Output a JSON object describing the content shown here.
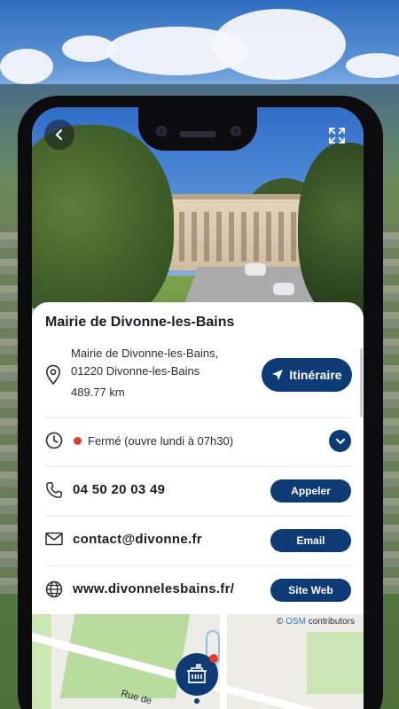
{
  "place": {
    "title": "Mairie de Divonne-les-Bains",
    "address_line1": "Mairie de Divonne-les-Bains,",
    "address_line2": "01220 Divonne-les-Bains",
    "distance": "489.77 km",
    "directions_label": "Itinéraire"
  },
  "hours": {
    "status_text": "Fermé (ouvre lundi à 07h30)",
    "status_color": "#e03a2e"
  },
  "contact": {
    "phone": "04 50 20 03 49",
    "phone_button": "Appeler",
    "email": "contact@divonne.fr",
    "email_button": "Email",
    "website": "www.divonnelesbains.fr/",
    "website_button": "Site Web"
  },
  "map": {
    "street_label": "Rue de",
    "attribution_symbol": "©",
    "attribution_link": "OSM",
    "attribution_text": "contributors"
  },
  "icons": {
    "back": "back-arrow-icon",
    "fullscreen": "fullscreen-icon",
    "location": "location-pin-icon",
    "navigation": "navigation-arrow-icon",
    "clock": "clock-icon",
    "expand": "chevron-down-icon",
    "phone": "phone-icon",
    "email": "envelope-icon",
    "web": "globe-icon",
    "marker": "town-hall-icon"
  },
  "colors": {
    "primary": "#0e3a76",
    "closed": "#e03a2e",
    "link": "#2f7ad4"
  }
}
